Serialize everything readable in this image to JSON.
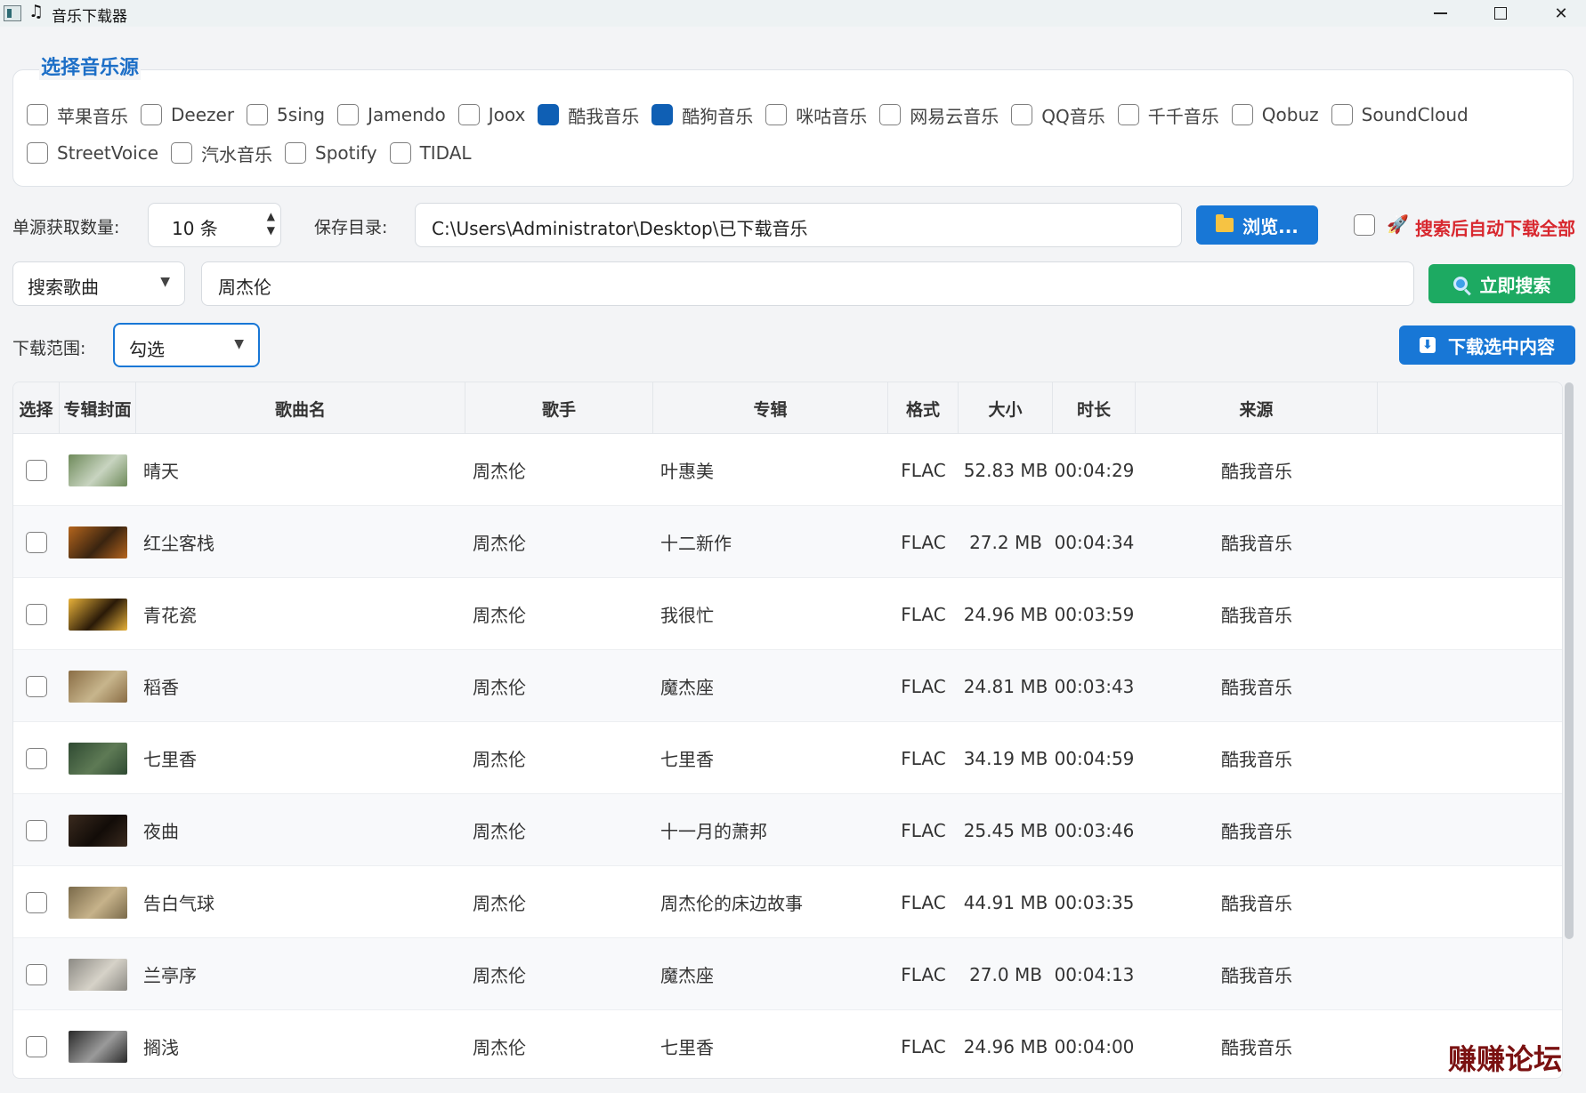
{
  "window": {
    "title": "音乐下载器",
    "minimize_icon": "minimize-icon",
    "maximize_icon": "maximize-icon",
    "close_icon": "close-icon"
  },
  "sources": {
    "title": "选择音乐源",
    "row1": [
      {
        "label": "苹果音乐",
        "checked": false
      },
      {
        "label": "Deezer",
        "checked": false
      },
      {
        "label": "5sing",
        "checked": false
      },
      {
        "label": "Jamendo",
        "checked": false
      },
      {
        "label": "Joox",
        "checked": false
      },
      {
        "label": "酷我音乐",
        "checked": true
      },
      {
        "label": "酷狗音乐",
        "checked": true
      },
      {
        "label": "咪咕音乐",
        "checked": false
      },
      {
        "label": "网易云音乐",
        "checked": false
      },
      {
        "label": "QQ音乐",
        "checked": false
      },
      {
        "label": "千千音乐",
        "checked": false
      },
      {
        "label": "Qobuz",
        "checked": false
      },
      {
        "label": "SoundCloud",
        "checked": false
      }
    ],
    "row2": [
      {
        "label": "StreetVoice",
        "checked": false
      },
      {
        "label": "汽水音乐",
        "checked": false
      },
      {
        "label": "Spotify",
        "checked": false
      },
      {
        "label": "TIDAL",
        "checked": false
      }
    ]
  },
  "controls": {
    "count_label": "单源获取数量:",
    "count_value": "10 条",
    "save_dir_label": "保存目录:",
    "save_dir_value": "C:\\Users\\Administrator\\Desktop\\已下载音乐",
    "browse_label": "浏览...",
    "auto_download_label": "搜索后自动下载全部",
    "auto_download_checked": false,
    "search_mode": "搜索歌曲",
    "search_query": "周杰伦",
    "search_button": "立即搜索",
    "range_label": "下载范围:",
    "range_value": "勾选",
    "download_button": "下载选中内容"
  },
  "table": {
    "headers": [
      "选择",
      "专辑封面",
      "歌曲名",
      "歌手",
      "专辑",
      "格式",
      "大小",
      "时长",
      "来源"
    ],
    "rows": [
      {
        "title": "晴天",
        "artist": "周杰伦",
        "album": "叶惠美",
        "format": "FLAC",
        "size": "52.83 MB",
        "duration": "00:04:29",
        "source": "酷我音乐",
        "cover_colors": [
          "#6e8a5a",
          "#c8d4c0"
        ]
      },
      {
        "title": "红尘客栈",
        "artist": "周杰伦",
        "album": "十二新作",
        "format": "FLAC",
        "size": "27.2 MB",
        "duration": "00:04:34",
        "source": "酷我音乐",
        "cover_colors": [
          "#b5651d",
          "#3a2410"
        ]
      },
      {
        "title": "青花瓷",
        "artist": "周杰伦",
        "album": "我很忙",
        "format": "FLAC",
        "size": "24.96 MB",
        "duration": "00:03:59",
        "source": "酷我音乐",
        "cover_colors": [
          "#e8b23a",
          "#2a1a08"
        ]
      },
      {
        "title": "稻香",
        "artist": "周杰伦",
        "album": "魔杰座",
        "format": "FLAC",
        "size": "24.81 MB",
        "duration": "00:03:43",
        "source": "酷我音乐",
        "cover_colors": [
          "#8a6d45",
          "#c7b58c"
        ]
      },
      {
        "title": "七里香",
        "artist": "周杰伦",
        "album": "七里香",
        "format": "FLAC",
        "size": "34.19 MB",
        "duration": "00:04:59",
        "source": "酷我音乐",
        "cover_colors": [
          "#2f4a32",
          "#5e7a55"
        ]
      },
      {
        "title": "夜曲",
        "artist": "周杰伦",
        "album": "十一月的萧邦",
        "format": "FLAC",
        "size": "25.45 MB",
        "duration": "00:03:46",
        "source": "酷我音乐",
        "cover_colors": [
          "#3a2a1e",
          "#120c08"
        ]
      },
      {
        "title": "告白气球",
        "artist": "周杰伦",
        "album": "周杰伦的床边故事",
        "format": "FLAC",
        "size": "44.91 MB",
        "duration": "00:03:35",
        "source": "酷我音乐",
        "cover_colors": [
          "#7a6a4a",
          "#c6b28a"
        ]
      },
      {
        "title": "兰亭序",
        "artist": "周杰伦",
        "album": "魔杰座",
        "format": "FLAC",
        "size": "27.0 MB",
        "duration": "00:04:13",
        "source": "酷我音乐",
        "cover_colors": [
          "#8c8a84",
          "#d6d2c8"
        ]
      },
      {
        "title": "搁浅",
        "artist": "周杰伦",
        "album": "七里香",
        "format": "FLAC",
        "size": "24.96 MB",
        "duration": "00:04:00",
        "source": "酷我音乐",
        "cover_colors": [
          "#2a2a2a",
          "#9a9a9a"
        ]
      }
    ]
  },
  "watermark": "赚赚论坛"
}
